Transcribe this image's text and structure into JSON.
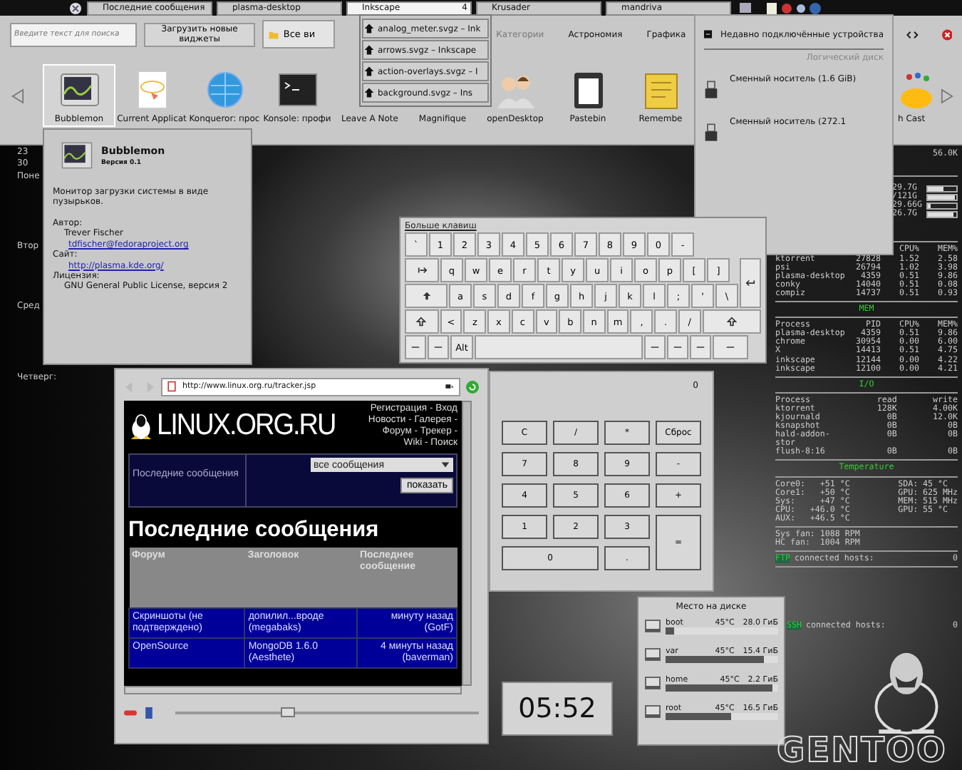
{
  "taskbar": {
    "tasks": [
      {
        "label": "Последние сообщения",
        "selected": false
      },
      {
        "label": "plasma-desktop",
        "selected": false
      },
      {
        "label": "Inkscape",
        "count": "4",
        "selected": true
      },
      {
        "label": "Krusader",
        "selected": false
      },
      {
        "label": "mandriva",
        "selected": false
      }
    ]
  },
  "widget_explorer": {
    "search": {
      "placeholder": "Введите текст для поиска"
    },
    "download_button": "Загрузить новые виджеты",
    "filter": "Все ви",
    "categories_label": "Категории",
    "categories": [
      "Астрономия",
      "Графика"
    ],
    "widgets": [
      {
        "name": "Bubblemon",
        "kind": "monitor",
        "selected": true
      },
      {
        "name": "Current Applicat",
        "kind": "note",
        "selected": false
      },
      {
        "name": "Konqueror: проc",
        "kind": "globe",
        "selected": false
      },
      {
        "name": "Konsole: профи",
        "kind": "terminal",
        "selected": false
      },
      {
        "name": "Leave A Note",
        "kind": "hidden",
        "selected": false
      },
      {
        "name": "Magnifique",
        "kind": "hidden",
        "selected": false
      },
      {
        "name": "openDesktop",
        "kind": "people",
        "selected": false
      },
      {
        "name": "Pastebin",
        "kind": "clipboard",
        "selected": false
      },
      {
        "name": "Remembe",
        "kind": "notepad",
        "selected": false
      }
    ],
    "widgets_right": [
      {
        "name": "h Cast",
        "kind": "bubbles",
        "selected": false
      }
    ]
  },
  "task_group_popup": {
    "items": [
      "analog_meter.svgz – Ink",
      "arrows.svgz – Inkscape",
      "action-overlays.svgz – I",
      "background.svgz – Ins"
    ]
  },
  "device_notifier": {
    "title": "Недавно подключённые устройства",
    "section": "Логический диск",
    "devices": [
      "Сменный носитель (1.6 GiB)",
      "Сменный носитель (272.1"
    ]
  },
  "calendar_fragments": [
    "23",
    "30",
    "Поне",
    "Втор",
    "Сред",
    "Четверг:"
  ],
  "tooltip": {
    "title": "Bubblemon",
    "version": "Версия 0.1",
    "description": "Монитор загрузки системы в виде пузырьков.",
    "author_label": "Автор:",
    "author": "Trever Fischer",
    "email": "tdfischer@fedoraproject.org",
    "site_label": "Сайт:",
    "site": "http://plasma.kde.org/",
    "license_label": "Лицензия:",
    "license": "GNU General Public License, версия 2"
  },
  "keyboard": {
    "title": "Больше клавиш",
    "rows": [
      [
        {
          "kind": "char",
          "label": "`"
        },
        {
          "kind": "char",
          "label": "1"
        },
        {
          "kind": "char",
          "label": "2"
        },
        {
          "kind": "char",
          "label": "3"
        },
        {
          "kind": "char",
          "label": "4"
        },
        {
          "kind": "char",
          "label": "5"
        },
        {
          "kind": "char",
          "label": "6"
        },
        {
          "kind": "char",
          "label": "7"
        },
        {
          "kind": "char",
          "label": "8"
        },
        {
          "kind": "char",
          "label": "9"
        },
        {
          "kind": "char",
          "label": "0"
        },
        {
          "kind": "char",
          "label": "-"
        }
      ],
      [
        {
          "kind": "tab"
        },
        {
          "kind": "char",
          "label": "q"
        },
        {
          "kind": "char",
          "label": "w"
        },
        {
          "kind": "char",
          "label": "e"
        },
        {
          "kind": "char",
          "label": "r"
        },
        {
          "kind": "char",
          "label": "t"
        },
        {
          "kind": "char",
          "label": "y"
        },
        {
          "kind": "char",
          "label": "u"
        },
        {
          "kind": "char",
          "label": "i"
        },
        {
          "kind": "char",
          "label": "o"
        },
        {
          "kind": "char",
          "label": "p"
        },
        {
          "kind": "char",
          "label": "["
        },
        {
          "kind": "char",
          "label": "]"
        },
        {
          "kind": "enter"
        }
      ],
      [
        {
          "kind": "caps"
        },
        {
          "kind": "char",
          "label": "a"
        },
        {
          "kind": "char",
          "label": "s"
        },
        {
          "kind": "char",
          "label": "d"
        },
        {
          "kind": "char",
          "label": "f"
        },
        {
          "kind": "char",
          "label": "g"
        },
        {
          "kind": "char",
          "label": "h"
        },
        {
          "kind": "char",
          "label": "j"
        },
        {
          "kind": "char",
          "label": "k"
        },
        {
          "kind": "char",
          "label": "l"
        },
        {
          "kind": "char",
          "label": ";"
        },
        {
          "kind": "char",
          "label": "'"
        },
        {
          "kind": "char",
          "label": "\\"
        }
      ],
      [
        {
          "kind": "shift"
        },
        {
          "kind": "char",
          "label": "<"
        },
        {
          "kind": "char",
          "label": "z"
        },
        {
          "kind": "char",
          "label": "x"
        },
        {
          "kind": "char",
          "label": "c"
        },
        {
          "kind": "char",
          "label": "v"
        },
        {
          "kind": "char",
          "label": "b"
        },
        {
          "kind": "char",
          "label": "n"
        },
        {
          "kind": "char",
          "label": "m"
        },
        {
          "kind": "char",
          "label": ","
        },
        {
          "kind": "char",
          "label": "."
        },
        {
          "kind": "char",
          "label": "/"
        },
        {
          "kind": "shift_wide"
        }
      ],
      [
        {
          "kind": "blank"
        },
        {
          "kind": "blank"
        },
        {
          "kind": "char",
          "label": "Alt"
        },
        {
          "kind": "space"
        },
        {
          "kind": "blank"
        },
        {
          "kind": "blank"
        },
        {
          "kind": "blank"
        },
        {
          "kind": "blank_wide"
        }
      ]
    ]
  },
  "system_monitor": {
    "net_rate": "56.0K",
    "bars": [
      {
        "reading": "29.7G",
        "level": 0.55
      },
      {
        "reading": "/121G",
        "level": 0.95
      },
      {
        "reading": "29.66G",
        "level": 0.1
      },
      {
        "reading": "26.7G",
        "level": 0.9
      }
    ],
    "cpu_table": {
      "columns": [
        "",
        "",
        "CPU%",
        "MEM%"
      ],
      "rows": [
        [
          "ktorrent",
          "27828",
          "1.52",
          "2.58"
        ],
        [
          "psi",
          "26794",
          "1.02",
          "3.98"
        ],
        [
          "plasma-desktop",
          "4359",
          "0.51",
          "9.86"
        ],
        [
          "conky",
          "14040",
          "0.51",
          "0.08"
        ],
        [
          "compiz",
          "14737",
          "0.51",
          "0.93"
        ]
      ]
    },
    "sections": [
      {
        "title": "MEM",
        "columns": [
          "Process",
          "PID",
          "CPU%",
          "MEM%"
        ],
        "rows": [
          [
            "plasma-desktop",
            "4359",
            "0.51",
            "9.86"
          ],
          [
            "chrome",
            "30954",
            "0.00",
            "6.00"
          ],
          [
            "X",
            "14413",
            "0.51",
            "4.75"
          ],
          [
            "inkscape",
            "12144",
            "0.00",
            "4.22"
          ],
          [
            "inkscape",
            "12100",
            "0.00",
            "4.21"
          ]
        ]
      },
      {
        "title": "I/O",
        "columns": [
          "Process",
          "read",
          "write"
        ],
        "rows": [
          [
            "ktorrent",
            "128K",
            "4.00K"
          ],
          [
            "kjournald",
            "0B",
            "12.0K"
          ],
          [
            "ksnapshot",
            "0B",
            "0B"
          ],
          [
            "hald-addon-stor",
            "0B",
            "0B"
          ],
          [
            "flush-8:16",
            "0B",
            "0B"
          ]
        ]
      }
    ],
    "temperature": {
      "title": "Temperature",
      "left": [
        "Core0:   +51 °C",
        "Core1:   +50 °C",
        "Sys:     +47 °C",
        "CPU:   +46.0 °C",
        "AUX:   +46.5 °C"
      ],
      "right": [
        "SDA: 45 °C",
        "GPU: 625 MHz",
        "MEM: 515 MHz",
        "GPU: 55 °C"
      ]
    },
    "fans": [
      "Sys fan: 1088 RPM",
      "HC fan:  1004 RPM"
    ],
    "hosts": [
      {
        "label": "FTP",
        "text": "connected hosts:",
        "count": "0"
      },
      {
        "label": "SSH",
        "text": "connected hosts:",
        "count": "0"
      }
    ]
  },
  "browser": {
    "url": "http://www.linux.org.ru/tracker.jsp",
    "site_logo": "LINUX.ORG.RU",
    "nav_links": [
      "Регистрация - Вход",
      "Новости - Галерея -",
      "Форум - Трекер -",
      "Wiki - Поиск"
    ],
    "filter_label": "Последние сообщения",
    "filter_select": "все сообщения",
    "filter_button": "показать",
    "heading": "Последние сообщения",
    "table": {
      "columns": [
        "Форум",
        "Заголовок",
        "Последнее сообщение"
      ],
      "rows": [
        [
          "Скриншоты (не подтверждено)",
          "допилил...вроде (megabaks)",
          "минуту назад (GotF)"
        ],
        [
          "OpenSource",
          "MongoDB 1.6.0 (Aesthete)",
          "4 минуты назад (baverman)"
        ]
      ]
    },
    "zoom_slider": {
      "level": 0.37
    }
  },
  "calculator": {
    "display": "0",
    "buttons": [
      {
        "label": "C",
        "kind": "normal"
      },
      {
        "label": "/",
        "kind": "normal"
      },
      {
        "label": "*",
        "kind": "normal"
      },
      {
        "label": "Сброс",
        "kind": "normal"
      },
      {
        "label": "7",
        "kind": "normal"
      },
      {
        "label": "8",
        "kind": "normal"
      },
      {
        "label": "9",
        "kind": "normal"
      },
      {
        "label": "-",
        "kind": "normal"
      },
      {
        "label": "4",
        "kind": "normal"
      },
      {
        "label": "5",
        "kind": "normal"
      },
      {
        "label": "6",
        "kind": "normal"
      },
      {
        "label": "+",
        "kind": "normal"
      },
      {
        "label": "1",
        "kind": "normal"
      },
      {
        "label": "2",
        "kind": "normal"
      },
      {
        "label": "3",
        "kind": "normal"
      },
      {
        "label": "=",
        "kind": "tall"
      },
      {
        "label": "0",
        "kind": "wide"
      },
      {
        "label": ".",
        "kind": "normal"
      }
    ]
  },
  "clock": {
    "time": "05:52"
  },
  "disk_space": {
    "title": "Место на диске",
    "disks": [
      {
        "name": "boot",
        "temp": "45°C",
        "size": "28.0 ГиБ",
        "level": 0.07
      },
      {
        "name": "var",
        "temp": "45°C",
        "size": "15.4 ГиБ",
        "level": 0.87
      },
      {
        "name": "home",
        "temp": "45°C",
        "size": "2.2 ГиБ",
        "level": 0.95
      },
      {
        "name": "root",
        "temp": "45°C",
        "size": "16.5 ГиБ",
        "level": 0.58
      }
    ]
  },
  "distro_logo": "GENTOO"
}
